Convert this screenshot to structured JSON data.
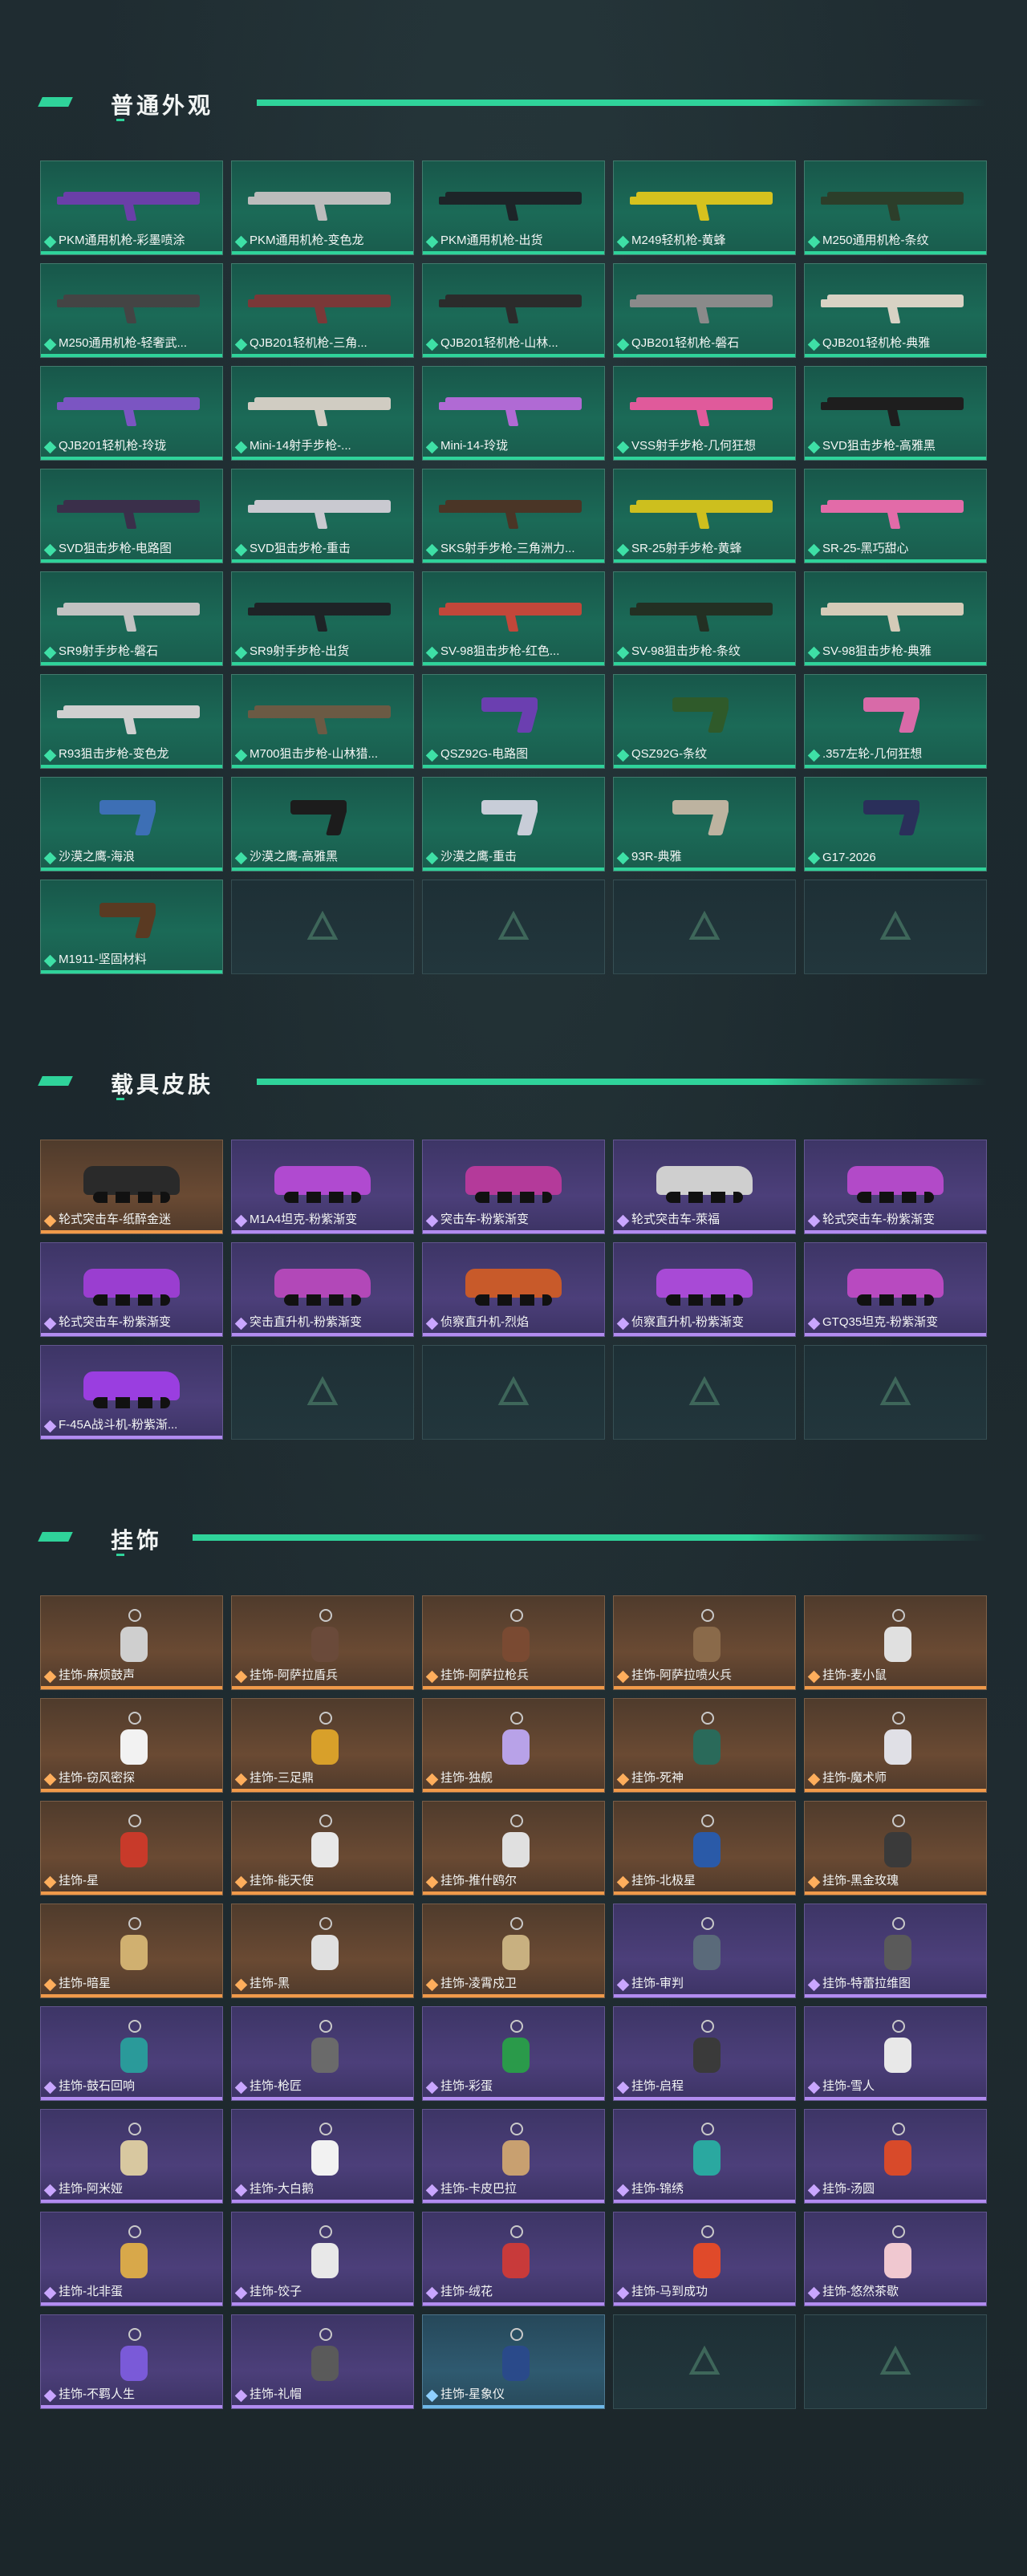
{
  "sections": [
    {
      "title": "普通外观",
      "cards": [
        {
          "label": "PKM通用机枪-彩墨喷涂",
          "rarity": "green",
          "art": "gun",
          "color": "#6a3fa8"
        },
        {
          "label": "PKM通用机枪-变色龙",
          "rarity": "green",
          "art": "gun",
          "color": "#bcbcbc"
        },
        {
          "label": "PKM通用机枪-出货",
          "rarity": "green",
          "art": "gun",
          "color": "#1d2428"
        },
        {
          "label": "M249轻机枪-黄蜂",
          "rarity": "green",
          "art": "gun",
          "color": "#d6c21e"
        },
        {
          "label": "M250通用机枪-条纹",
          "rarity": "green",
          "art": "gun",
          "color": "#2c3e2a"
        },
        {
          "label": "M250通用机枪-轻奢武...",
          "rarity": "green",
          "art": "gun",
          "color": "#444"
        },
        {
          "label": "QJB201轻机枪-三角...",
          "rarity": "green",
          "art": "gun",
          "color": "#7a3838"
        },
        {
          "label": "QJB201轻机枪-山林...",
          "rarity": "green",
          "art": "gun",
          "color": "#2b2b2b"
        },
        {
          "label": "QJB201轻机枪-磐石",
          "rarity": "green",
          "art": "gun",
          "color": "#8a8a8a"
        },
        {
          "label": "QJB201轻机枪-典雅",
          "rarity": "green",
          "art": "gun",
          "color": "#d8d2c4"
        },
        {
          "label": "QJB201轻机枪-玲珑",
          "rarity": "green",
          "art": "gun",
          "color": "#7b55c2"
        },
        {
          "label": "Mini-14射手步枪-...",
          "rarity": "green",
          "art": "gun",
          "color": "#d0ccc2"
        },
        {
          "label": "Mini-14-玲珑",
          "rarity": "green",
          "art": "gun",
          "color": "#b06ad4"
        },
        {
          "label": "VSS射手步枪-几何狂想",
          "rarity": "green",
          "art": "gun",
          "color": "#e05a9b"
        },
        {
          "label": "SVD狙击步枪-高雅黑",
          "rarity": "green",
          "art": "gun",
          "color": "#1e1e1e"
        },
        {
          "label": "SVD狙击步枪-电路图",
          "rarity": "green",
          "art": "gun",
          "color": "#3a2f4a"
        },
        {
          "label": "SVD狙击步枪-重击",
          "rarity": "green",
          "art": "gun",
          "color": "#c9c9d0"
        },
        {
          "label": "SKS射手步枪-三角洲力...",
          "rarity": "green",
          "art": "gun",
          "color": "#4a3526"
        },
        {
          "label": "SR-25射手步枪-黄蜂",
          "rarity": "green",
          "art": "gun",
          "color": "#cdbf1e"
        },
        {
          "label": "SR-25-黑巧甜心",
          "rarity": "green",
          "art": "gun",
          "color": "#e26ba8"
        },
        {
          "label": "SR9射手步枪-磐石",
          "rarity": "green",
          "art": "gun",
          "color": "#c2c2c2"
        },
        {
          "label": "SR9射手步枪-出货",
          "rarity": "green",
          "art": "gun",
          "color": "#1e2326"
        },
        {
          "label": "SV-98狙击步枪-红色...",
          "rarity": "green",
          "art": "gun",
          "color": "#c2473a"
        },
        {
          "label": "SV-98狙击步枪-条纹",
          "rarity": "green",
          "art": "gun",
          "color": "#233023"
        },
        {
          "label": "SV-98狙击步枪-典雅",
          "rarity": "green",
          "art": "gun",
          "color": "#d4cbb8"
        },
        {
          "label": "R93狙击步枪-变色龙",
          "rarity": "green",
          "art": "gun",
          "color": "#cfcfcf"
        },
        {
          "label": "M700狙击步枪-山林猎...",
          "rarity": "green",
          "art": "gun",
          "color": "#6b5a44"
        },
        {
          "label": "QSZ92G-电路图",
          "rarity": "green",
          "art": "pistol",
          "color": "#6b3fb0"
        },
        {
          "label": "QSZ92G-条纹",
          "rarity": "green",
          "art": "pistol",
          "color": "#2f5a2a"
        },
        {
          "label": ".357左轮-几何狂想",
          "rarity": "green",
          "art": "pistol",
          "color": "#d86aa8"
        },
        {
          "label": "沙漠之鹰-海浪",
          "rarity": "green",
          "art": "pistol",
          "color": "#3d6fb5"
        },
        {
          "label": "沙漠之鹰-高雅黑",
          "rarity": "green",
          "art": "pistol",
          "color": "#1c1c1c"
        },
        {
          "label": "沙漠之鹰-重击",
          "rarity": "green",
          "art": "pistol",
          "color": "#c8cdd8"
        },
        {
          "label": "93R-典雅",
          "rarity": "green",
          "art": "pistol",
          "color": "#bdb3a0"
        },
        {
          "label": "G17-2026",
          "rarity": "green",
          "art": "pistol",
          "color": "#2a2f5a"
        },
        {
          "label": "M1911-坚固材料",
          "rarity": "green",
          "art": "pistol",
          "color": "#5a3a22"
        },
        {
          "label": "",
          "rarity": "empty",
          "art": "none",
          "color": ""
        },
        {
          "label": "",
          "rarity": "empty",
          "art": "none",
          "color": ""
        },
        {
          "label": "",
          "rarity": "empty",
          "art": "none",
          "color": ""
        },
        {
          "label": "",
          "rarity": "empty",
          "art": "none",
          "color": ""
        }
      ]
    },
    {
      "title": "载具皮肤",
      "cards": [
        {
          "label": "轮式突击车-纸醉金迷",
          "rarity": "orange",
          "art": "veh",
          "color": "#2a2a2a"
        },
        {
          "label": "M1A4坦克-粉紫渐变",
          "rarity": "purple",
          "art": "veh",
          "color": "#b04ad0"
        },
        {
          "label": "突击车-粉紫渐变",
          "rarity": "purple",
          "art": "veh",
          "color": "#b43a9a"
        },
        {
          "label": "轮式突击车-萊福",
          "rarity": "purple",
          "art": "veh",
          "color": "#cfcfcf"
        },
        {
          "label": "轮式突击车-粉紫渐变",
          "rarity": "purple",
          "art": "veh",
          "color": "#b24ac8"
        },
        {
          "label": "轮式突击车-粉紫渐变",
          "rarity": "purple",
          "art": "veh",
          "color": "#9a3ed0"
        },
        {
          "label": "突击直升机-粉紫渐变",
          "rarity": "purple",
          "art": "veh",
          "color": "#b248b8"
        },
        {
          "label": "侦察直升机-烈焰",
          "rarity": "purple",
          "art": "veh",
          "color": "#c85a2a"
        },
        {
          "label": "侦察直升机-粉紫渐变",
          "rarity": "purple",
          "art": "veh",
          "color": "#a84ad6"
        },
        {
          "label": "GTQ35坦克-粉紫渐变",
          "rarity": "purple",
          "art": "veh",
          "color": "#b84ac0"
        },
        {
          "label": "F-45A战斗机-粉紫渐...",
          "rarity": "purple",
          "art": "veh",
          "color": "#9a3ee0"
        },
        {
          "label": "",
          "rarity": "empty",
          "art": "none",
          "color": ""
        },
        {
          "label": "",
          "rarity": "empty",
          "art": "none",
          "color": ""
        },
        {
          "label": "",
          "rarity": "empty",
          "art": "none",
          "color": ""
        },
        {
          "label": "",
          "rarity": "empty",
          "art": "none",
          "color": ""
        }
      ]
    },
    {
      "title": "挂饰",
      "cards": [
        {
          "label": "挂饰-麻烦鼓声",
          "rarity": "orange",
          "art": "charm",
          "color": "#cfcfcf"
        },
        {
          "label": "挂饰-阿萨拉盾兵",
          "rarity": "orange",
          "art": "charm",
          "color": "#6a4a3a"
        },
        {
          "label": "挂饰-阿萨拉枪兵",
          "rarity": "orange",
          "art": "charm",
          "color": "#7a4a32"
        },
        {
          "label": "挂饰-阿萨拉喷火兵",
          "rarity": "orange",
          "art": "charm",
          "color": "#8a6a4a"
        },
        {
          "label": "挂饰-麦小鼠",
          "rarity": "orange",
          "art": "charm",
          "color": "#e0e0e0"
        },
        {
          "label": "挂饰-窃风密探",
          "rarity": "orange",
          "art": "charm",
          "color": "#f2f2f2"
        },
        {
          "label": "挂饰-三足鼎",
          "rarity": "orange",
          "art": "charm",
          "color": "#d8a02a"
        },
        {
          "label": "挂饰-独舰",
          "rarity": "orange",
          "art": "charm",
          "color": "#b8a2e8"
        },
        {
          "label": "挂饰-死神",
          "rarity": "orange",
          "art": "charm",
          "color": "#2a6a5a"
        },
        {
          "label": "挂饰-魔术师",
          "rarity": "orange",
          "art": "charm",
          "color": "#e0e0e6"
        },
        {
          "label": "挂饰-星",
          "rarity": "orange",
          "art": "charm",
          "color": "#c83a2a"
        },
        {
          "label": "挂饰-能天使",
          "rarity": "orange",
          "art": "charm",
          "color": "#e8e8e8"
        },
        {
          "label": "挂饰-推什鸥尔",
          "rarity": "orange",
          "art": "charm",
          "color": "#e0e0e0"
        },
        {
          "label": "挂饰-北极星",
          "rarity": "orange",
          "art": "charm",
          "color": "#2a5aa8"
        },
        {
          "label": "挂饰-黑金玫瑰",
          "rarity": "orange",
          "art": "charm",
          "color": "#3a3a3a"
        },
        {
          "label": "挂饰-暗星",
          "rarity": "orange",
          "art": "charm",
          "color": "#d0b070"
        },
        {
          "label": "挂饰-黑",
          "rarity": "orange",
          "art": "charm",
          "color": "#e0e0e0"
        },
        {
          "label": "挂饰-凌霄戍卫",
          "rarity": "orange",
          "art": "charm",
          "color": "#c8b080"
        },
        {
          "label": "挂饰-审判",
          "rarity": "purple",
          "art": "charm",
          "color": "#5a6a7a"
        },
        {
          "label": "挂饰-特蕾拉维图",
          "rarity": "purple",
          "art": "charm",
          "color": "#5a5a5a"
        },
        {
          "label": "挂饰-鼓石回响",
          "rarity": "purple",
          "art": "charm",
          "color": "#2a9a9a"
        },
        {
          "label": "挂饰-枪匠",
          "rarity": "purple",
          "art": "charm",
          "color": "#6a6a6a"
        },
        {
          "label": "挂饰-彩蛋",
          "rarity": "purple",
          "art": "charm",
          "color": "#2a9a4a"
        },
        {
          "label": "挂饰-启程",
          "rarity": "purple",
          "art": "charm",
          "color": "#3a3a3a"
        },
        {
          "label": "挂饰-雪人",
          "rarity": "purple",
          "art": "charm",
          "color": "#e8e8e8"
        },
        {
          "label": "挂饰-阿米娅",
          "rarity": "purple",
          "art": "charm",
          "color": "#d8c8a0"
        },
        {
          "label": "挂饰-大白鹅",
          "rarity": "purple",
          "art": "charm",
          "color": "#f2f2f2"
        },
        {
          "label": "挂饰-卡皮巴拉",
          "rarity": "purple",
          "art": "charm",
          "color": "#c8a070"
        },
        {
          "label": "挂饰-锦绣",
          "rarity": "purple",
          "art": "charm",
          "color": "#2aa8a0"
        },
        {
          "label": "挂饰-汤圆",
          "rarity": "purple",
          "art": "charm",
          "color": "#d84a2a"
        },
        {
          "label": "挂饰-北非蛋",
          "rarity": "purple",
          "art": "charm",
          "color": "#d8a84a"
        },
        {
          "label": "挂饰-饺子",
          "rarity": "purple",
          "art": "charm",
          "color": "#e8e8e8"
        },
        {
          "label": "挂饰-绒花",
          "rarity": "purple",
          "art": "charm",
          "color": "#c83a3a"
        },
        {
          "label": "挂饰-马到成功",
          "rarity": "purple",
          "art": "charm",
          "color": "#e04a2a"
        },
        {
          "label": "挂饰-悠然茶歇",
          "rarity": "purple",
          "art": "charm",
          "color": "#f0c8d0"
        },
        {
          "label": "挂饰-不羁人生",
          "rarity": "purple",
          "art": "charm",
          "color": "#7a5ad8"
        },
        {
          "label": "挂饰-礼帽",
          "rarity": "purple",
          "art": "charm",
          "color": "#5a5a5a"
        },
        {
          "label": "挂饰-星象仪",
          "rarity": "blue",
          "art": "charm",
          "color": "#2a4a8a"
        },
        {
          "label": "",
          "rarity": "empty",
          "art": "none",
          "color": ""
        },
        {
          "label": "",
          "rarity": "empty",
          "art": "none",
          "color": ""
        }
      ]
    }
  ]
}
